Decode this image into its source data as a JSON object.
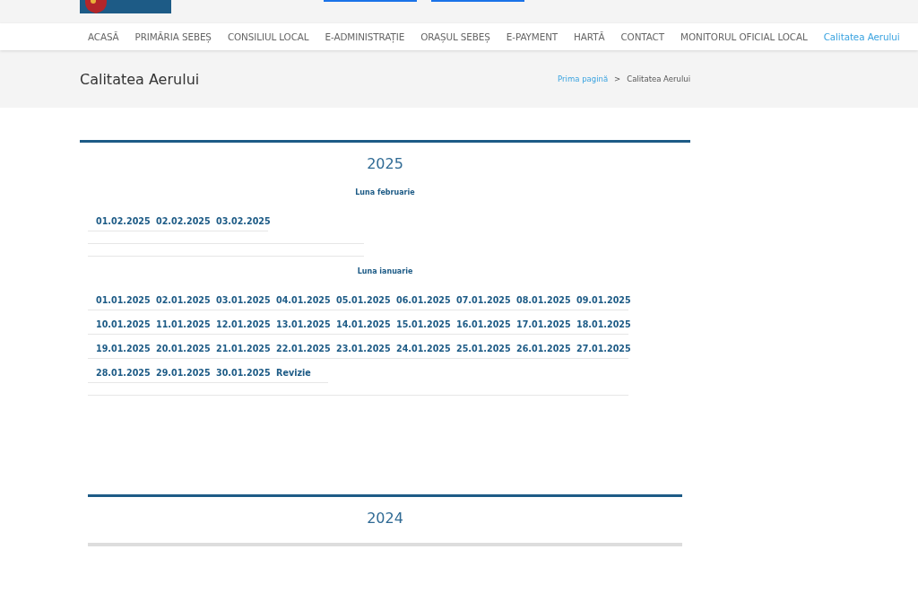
{
  "nav": [
    {
      "label": "ACASĂ",
      "selected": false
    },
    {
      "label": "PRIMĂRIA SEBEȘ",
      "selected": false
    },
    {
      "label": "CONSILIUL LOCAL",
      "selected": false
    },
    {
      "label": "E-ADMINISTRAȚIE",
      "selected": false
    },
    {
      "label": "ORAȘUL SEBEȘ",
      "selected": false
    },
    {
      "label": "E-PAYMENT",
      "selected": false
    },
    {
      "label": "HARTĂ",
      "selected": false
    },
    {
      "label": "CONTACT",
      "selected": false
    },
    {
      "label": "MONITORUL OFICIAL LOCAL",
      "selected": false
    },
    {
      "label": "Calitatea Aerului",
      "selected": true
    }
  ],
  "page_title": "Calitatea Aerului",
  "breadcrumb": {
    "home": "Prima pagină",
    "separator": ">",
    "current": "Calitatea Aerului"
  },
  "years": [
    {
      "year": "2025",
      "months": [
        {
          "title": "Luna februarie",
          "rows": [
            [
              "01.02.2025",
              "02.02.2025",
              "03.02.2025"
            ]
          ]
        },
        {
          "title": "Luna ianuarie",
          "rows": [
            [
              "01.01.2025",
              "02.01.2025",
              "03.01.2025",
              "04.01.2025",
              "05.01.2025",
              "06.01.2025",
              "07.01.2025",
              "08.01.2025",
              "09.01.2025"
            ],
            [
              "10.01.2025",
              "11.01.2025",
              "12.01.2025",
              "13.01.2025",
              "14.01.2025",
              "15.01.2025",
              "16.01.2025",
              "17.01.2025",
              "18.01.2025"
            ],
            [
              "19.01.2025",
              "20.01.2025",
              "21.01.2025",
              "22.01.2025",
              "23.01.2025",
              "24.01.2025",
              "25.01.2025",
              "26.01.2025",
              "27.01.2025"
            ],
            [
              "28.01.2025",
              "29.01.2025",
              "30.01.2025",
              "Revizie"
            ]
          ]
        }
      ]
    },
    {
      "year": "2024"
    }
  ]
}
